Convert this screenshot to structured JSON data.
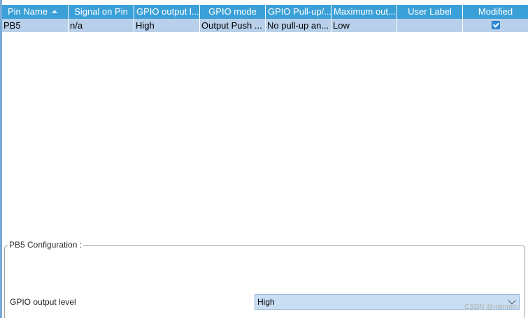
{
  "table": {
    "columns": [
      "Pin Name",
      "Signal on Pin",
      "GPIO output l...",
      "GPIO mode",
      "GPIO Pull-up/...",
      "Maximum out...",
      "User Label",
      "Modified"
    ],
    "rows": [
      {
        "pin_name": "PB5",
        "signal": "n/a",
        "output_level": "High",
        "mode": "Output Push ...",
        "pull": "No pull-up an...",
        "max_speed": "Low",
        "user_label": "",
        "modified": true
      }
    ]
  },
  "config": {
    "legend": "PB5 Configuration :",
    "field_label": "GPIO output level",
    "field_value": "High"
  },
  "watermark": "CSDN @mjmmm",
  "colors": {
    "header_bg": "#3ca0d8",
    "selected_row_bg": "#b8d0ea",
    "select_bg": "#c9def2"
  }
}
